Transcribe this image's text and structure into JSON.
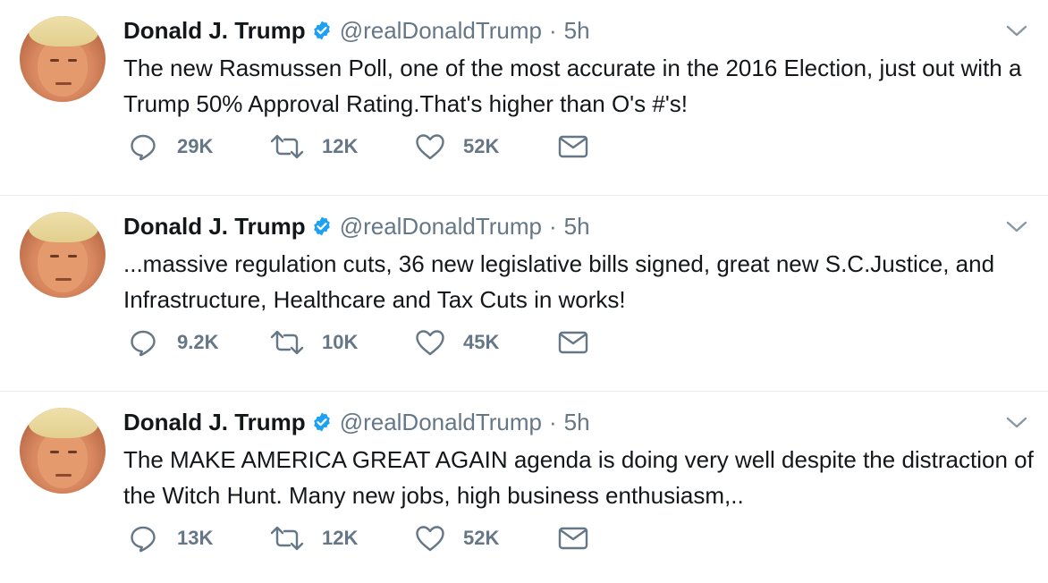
{
  "tweets": [
    {
      "name": "Donald J. Trump",
      "handle": "@realDonaldTrump",
      "separator": "·",
      "time": "5h",
      "text": "The new Rasmussen Poll, one of the most accurate in the 2016 Election, just out with a Trump 50% Approval Rating.That's higher than O's #'s!",
      "replies": "29K",
      "retweets": "12K",
      "likes": "52K"
    },
    {
      "name": "Donald J. Trump",
      "handle": "@realDonaldTrump",
      "separator": "·",
      "time": "5h",
      "text": "...massive regulation cuts, 36 new legislative bills signed, great new S.C.Justice, and Infrastructure, Healthcare and Tax Cuts in works!",
      "replies": "9.2K",
      "retweets": "10K",
      "likes": "45K"
    },
    {
      "name": "Donald J. Trump",
      "handle": "@realDonaldTrump",
      "separator": "·",
      "time": "5h",
      "text": "The MAKE AMERICA GREAT AGAIN agenda is doing very well despite the distraction of the Witch Hunt. Many new jobs, high business enthusiasm,..",
      "replies": "13K",
      "retweets": "12K",
      "likes": "52K"
    }
  ],
  "colors": {
    "verified": "#1da1f2",
    "secondary_text": "#657786",
    "primary_text": "#14171a",
    "divider": "#e6ecf0"
  },
  "icons": {
    "reply": "reply-icon",
    "retweet": "retweet-icon",
    "like": "heart-icon",
    "message": "envelope-icon",
    "verified": "verified-badge-icon",
    "menu": "chevron-down-icon"
  }
}
